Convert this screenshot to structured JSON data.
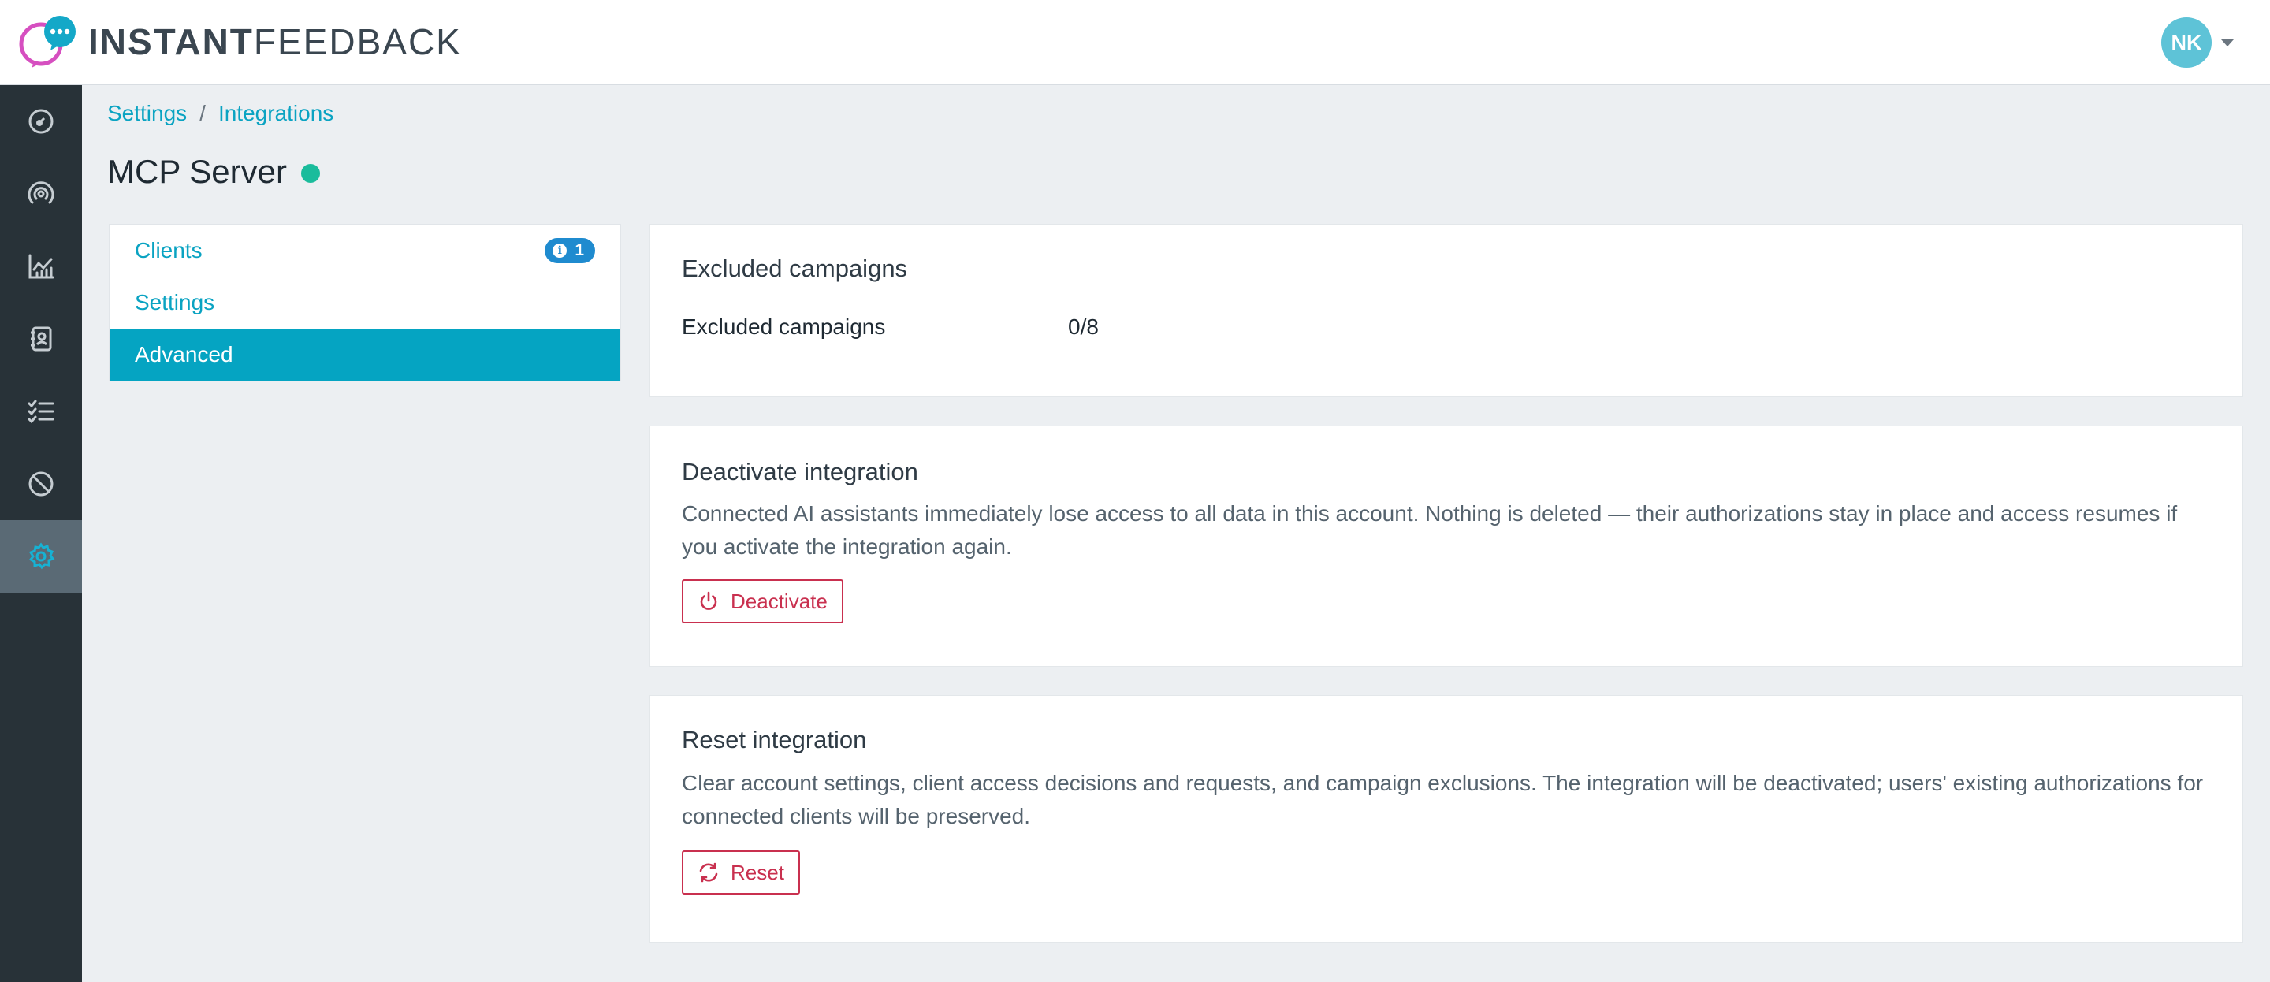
{
  "app": {
    "logo_bold": "INSTANT",
    "logo_light": "FEEDBACK",
    "user_initials": "NK"
  },
  "sidebar": {
    "items": [
      {
        "icon": "dashboard-gauge-icon"
      },
      {
        "icon": "broadcast-icon"
      },
      {
        "icon": "analytics-chart-icon"
      },
      {
        "icon": "contacts-book-icon"
      },
      {
        "icon": "checklist-icon"
      },
      {
        "icon": "blocked-icon"
      },
      {
        "icon": "settings-gear-icon",
        "active": true
      }
    ]
  },
  "breadcrumb": {
    "items": [
      "Settings",
      "Integrations"
    ],
    "separator": "/"
  },
  "page": {
    "title": "MCP Server",
    "status_color": "#1abc9c"
  },
  "subnav": {
    "clients_label": "Clients",
    "clients_badge": "1",
    "settings_label": "Settings",
    "advanced_label": "Advanced"
  },
  "excluded": {
    "title": "Excluded campaigns",
    "row_label": "Excluded campaigns",
    "row_value": "0/8"
  },
  "deactivate": {
    "title": "Deactivate integration",
    "description": "Connected AI assistants immediately lose access to all data in this account. Nothing is deleted — their authorizations stay in place and access resumes if you activate the integration again.",
    "button_label": "Deactivate"
  },
  "reset": {
    "title": "Reset integration",
    "description": "Clear account settings, client access decisions and requests, and campaign exclusions. The integration will be deactivated; users' existing authorizations for connected clients will be preserved.",
    "button_label": "Reset"
  },
  "colors": {
    "accent": "#05a4c2",
    "danger": "#c9304f",
    "sidebar": "#283238"
  }
}
